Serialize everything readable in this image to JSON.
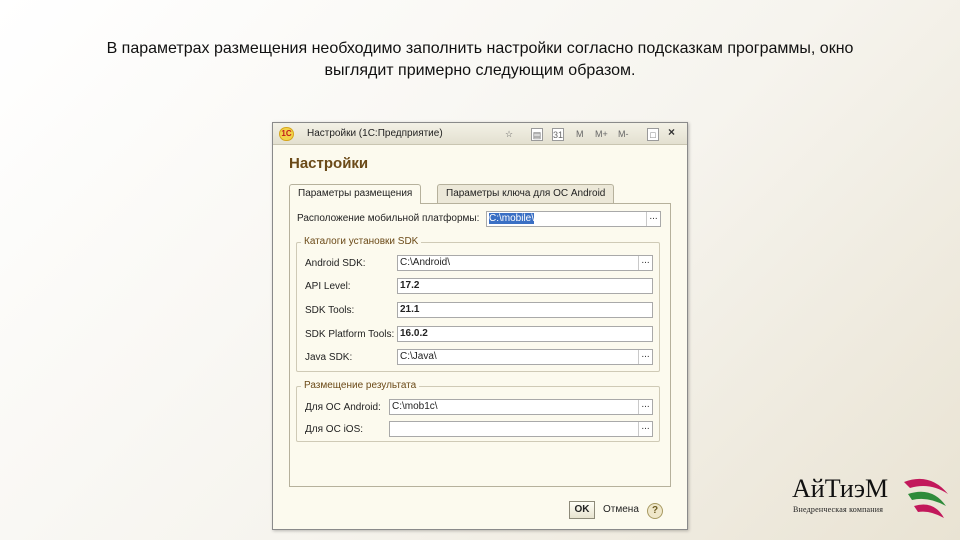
{
  "caption": {
    "line1": "В параметрах размещения необходимо заполнить настройки согласно подсказкам программы, окно",
    "line2": "выглядит примерно следующим образом."
  },
  "window": {
    "app_logo": "1С",
    "title": "Настройки (1С:Предприятие)",
    "toolbar_icons": [
      "favorite-icon",
      "copy-icon",
      "calendar-icon",
      "M",
      "M+",
      "M-",
      "maximize-icon",
      "close-icon"
    ],
    "heading": "Настройки",
    "tabs": [
      {
        "label": "Параметры размещения",
        "active": true
      },
      {
        "label": "Параметры ключа для ОС Android",
        "active": false
      }
    ],
    "mobile_platform": {
      "label": "Расположение мобильной платформы:",
      "value": "C:\\mobile\\"
    },
    "sdk_group": {
      "title": "Каталоги установки SDK",
      "android_sdk": {
        "label": "Android SDK:",
        "value": "C:\\Android\\"
      },
      "api_level": {
        "label": "API Level:",
        "value": "17.2"
      },
      "sdk_tools": {
        "label": "SDK Tools:",
        "value": "21.1"
      },
      "sdk_platform_tools": {
        "label": "SDK Platform Tools:",
        "value": "16.0.2"
      },
      "java_sdk": {
        "label": "Java SDK:",
        "value": "C:\\Java\\"
      }
    },
    "result_group": {
      "title": "Размещение результата",
      "android": {
        "label": "Для ОС Android:",
        "value": "C:\\mob1c\\"
      },
      "ios": {
        "label": "Для ОС iOS:",
        "value": ""
      }
    },
    "ellipsis": "...",
    "ok_label": "OK",
    "cancel_label": "Отмена",
    "help_label": "?"
  },
  "brand": {
    "name": "АйТиэМ",
    "subtitle": "Внедренческая компания",
    "colors": {
      "pink": "#c2185b",
      "green": "#2e8b3a"
    }
  }
}
